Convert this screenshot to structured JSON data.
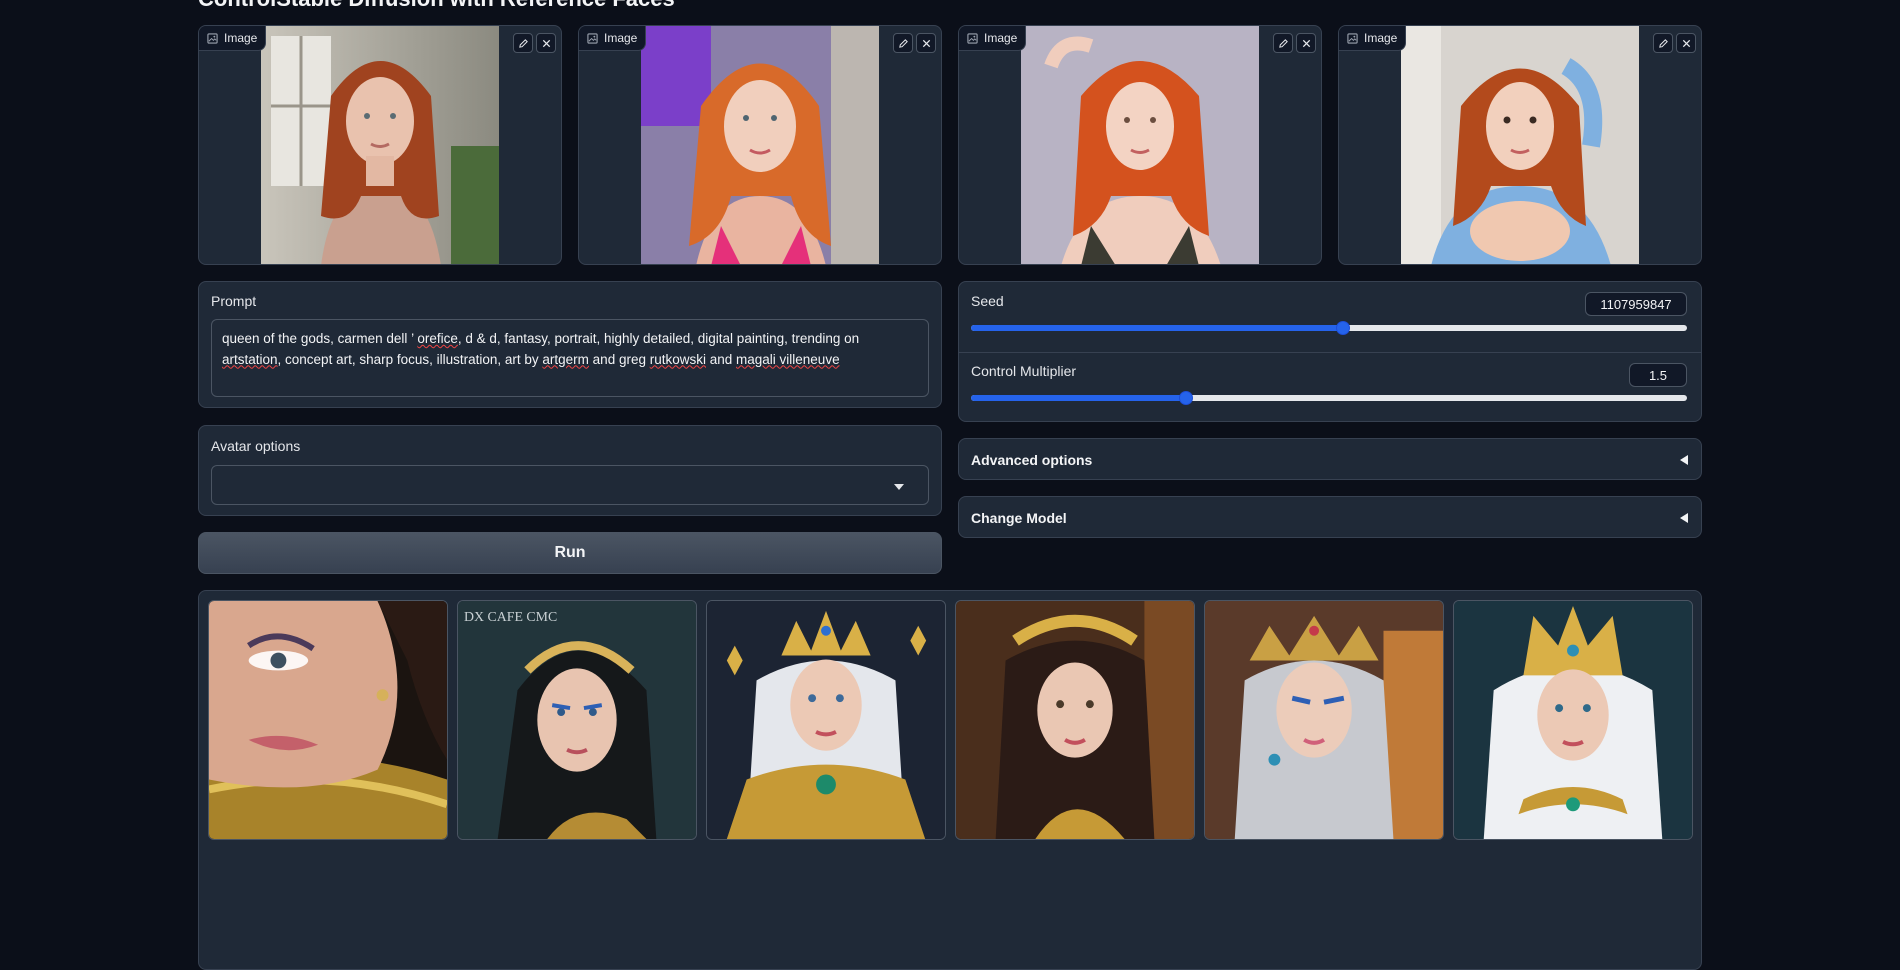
{
  "page": {
    "title": "ControlStable Diffusion with Reference Faces"
  },
  "input_images": [
    {
      "label": "Image",
      "image": "portrait-red-hair-window"
    },
    {
      "label": "Image",
      "image": "portrait-red-hair-pink-top"
    },
    {
      "label": "Image",
      "image": "portrait-red-hair-green-top"
    },
    {
      "label": "Image",
      "image": "portrait-red-hair-blue-sweater"
    }
  ],
  "prompt": {
    "label": "Prompt",
    "parts": [
      {
        "text": "queen of the gods, carmen dell ’ ",
        "spell": false
      },
      {
        "text": "orefice",
        "spell": true
      },
      {
        "text": ", d & d, fantasy, portrait, highly detailed, digital painting, trending on ",
        "spell": false
      },
      {
        "text": "artstation",
        "spell": true
      },
      {
        "text": ", concept art, sharp focus, illustration, art by ",
        "spell": false
      },
      {
        "text": "artgerm",
        "spell": true
      },
      {
        "text": " and greg ",
        "spell": false
      },
      {
        "text": "rutkowski",
        "spell": true
      },
      {
        "text": " and ",
        "spell": false
      },
      {
        "text": "magali villeneuve",
        "spell": true
      }
    ]
  },
  "avatar_options": {
    "label": "Avatar options",
    "selected": ""
  },
  "run_button": {
    "label": "Run"
  },
  "seed": {
    "label": "Seed",
    "value": "1107959847",
    "slider_fraction": 0.52
  },
  "control_multiplier": {
    "label": "Control Multiplier",
    "value": "1.5",
    "slider_fraction": 0.3
  },
  "advanced_options": {
    "label": "Advanced options"
  },
  "change_model": {
    "label": "Change Model"
  },
  "gallery": {
    "items": [
      {
        "image": "gold-armor-closeup"
      },
      {
        "image": "queen-dark-hair-tiara"
      },
      {
        "image": "queen-white-hair-gold-crown"
      },
      {
        "image": "queen-brown-hair-jeweled-crown"
      },
      {
        "image": "queen-silver-hair-ornate-crown"
      },
      {
        "image": "queen-white-hair-tall-crown"
      }
    ],
    "watermark": "DX CAFE CMC"
  },
  "colors": {
    "background": "#0b0f19",
    "panel": "#1f2937",
    "border": "#374151",
    "accent": "#2563eb"
  }
}
